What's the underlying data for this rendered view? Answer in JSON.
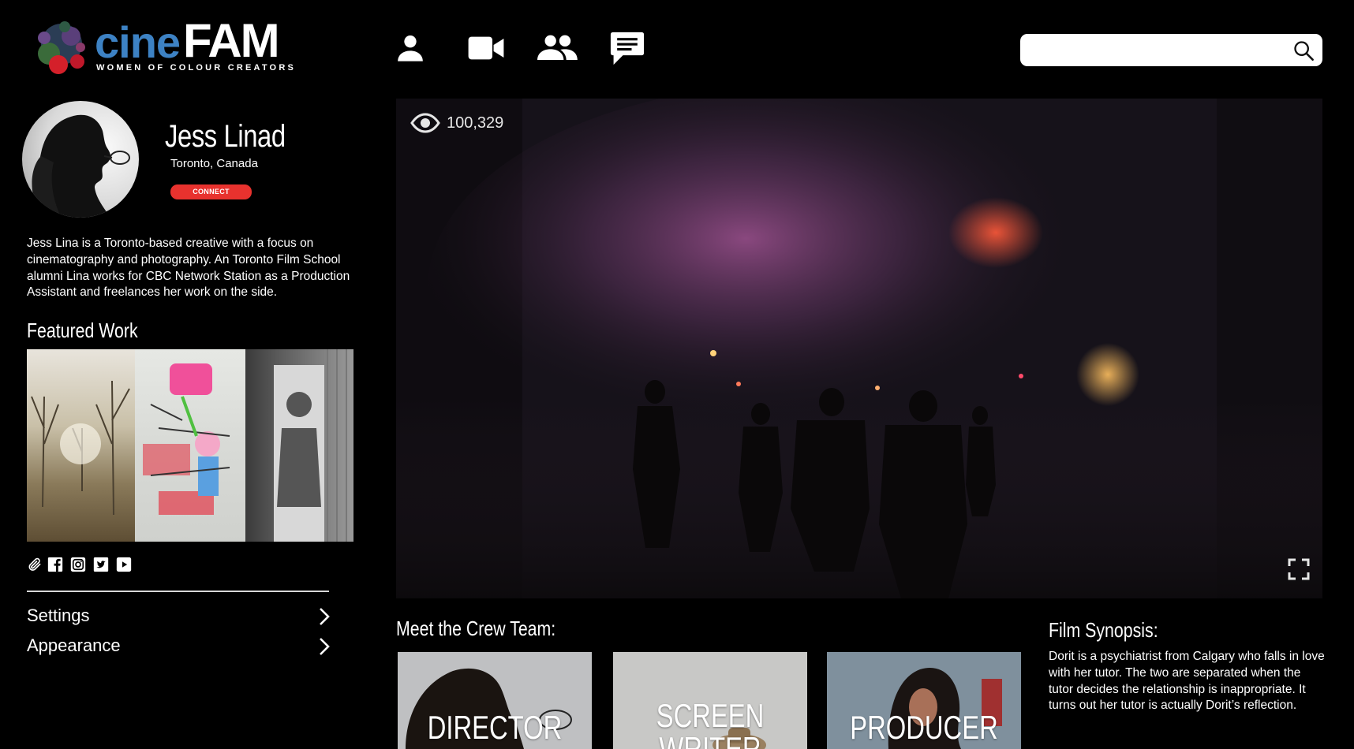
{
  "brand": {
    "name_part1": "cine",
    "name_part2": "FAM",
    "tagline": "WOMEN OF COLOUR CREATORS",
    "accent": "#3d82c4"
  },
  "nav": [
    {
      "icon": "person-icon"
    },
    {
      "icon": "video-camera-icon"
    },
    {
      "icon": "group-icon"
    },
    {
      "icon": "chat-icon"
    }
  ],
  "search": {
    "value": "",
    "icon": "search-icon"
  },
  "profile": {
    "name": "Jess Linad",
    "location": "Toronto, Canada",
    "connect_label": "CONNECT",
    "connect_color": "#e8322e",
    "bio": "Jess Lina is a Toronto-based creative with a focus on cinematography and photography. An Toronto Film School alumni Lina works for CBC Network Station as a Production Assistant and freelances her work on the side."
  },
  "featured": {
    "title": "Featured Work",
    "images": [
      "trees-photo",
      "graffiti-wall-photo",
      "street-art-photo"
    ]
  },
  "social_icons": [
    "attachment-icon",
    "facebook-icon",
    "instagram-icon",
    "twitter-icon",
    "youtube-icon"
  ],
  "menu": [
    {
      "label": "Settings"
    },
    {
      "label": "Appearance"
    }
  ],
  "video": {
    "views": "100,329"
  },
  "crew": {
    "title": "Meet the Crew Team:",
    "cards": [
      {
        "label": "DIRECTOR"
      },
      {
        "label": "SCREEN WRITER"
      },
      {
        "label": "PRODUCER"
      }
    ]
  },
  "synopsis": {
    "title": "Film Synopsis:",
    "text": "Dorit is a psychiatrist from Calgary who falls in love with her tutor. The two are separated when the tutor decides the relationship is inappropriate. It turns out her tutor is actually Dorit’s reflection."
  }
}
